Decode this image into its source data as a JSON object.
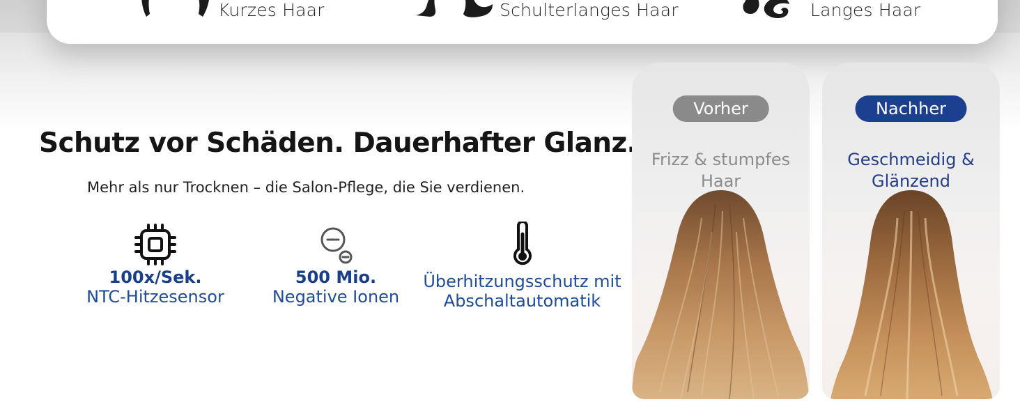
{
  "hair_types": [
    {
      "label": "Kurzes Haar",
      "icon": "short-hair-icon"
    },
    {
      "label": "Schulterlanges Haar",
      "icon": "shoulder-hair-icon"
    },
    {
      "label": "Langes Haar",
      "icon": "long-hair-icon"
    }
  ],
  "hero": {
    "headline": "Schutz vor Schäden. Dauerhafter Glanz.",
    "subline": "Mehr als nur Trocknen – die Salon-Pflege, die Sie verdienen."
  },
  "features": [
    {
      "icon": "chip-sensor-icon",
      "value": "100x/Sek.",
      "desc": "NTC-Hitzesensor"
    },
    {
      "icon": "negative-ions-icon",
      "value": "500 Mio.",
      "desc": "Negative Ionen"
    },
    {
      "icon": "thermometer-icon",
      "value": "",
      "desc_line1": "Überhitzungsschutz mit",
      "desc_line2": "Abschaltautomatik"
    }
  ],
  "comparison": {
    "before": {
      "badge": "Vorher",
      "caption_line1": "Frizz & stumpfes",
      "caption_line2": "Haar"
    },
    "after": {
      "badge": "Nachher",
      "caption_line1": "Geschmeidig &",
      "caption_line2": "Glänzend"
    }
  },
  "colors": {
    "brand_blue": "#1a3f8a",
    "badge_before": "#8a8a8a",
    "badge_after": "#1d3f8f",
    "caption_before": "#8b8b8b",
    "caption_after": "#243f86"
  }
}
